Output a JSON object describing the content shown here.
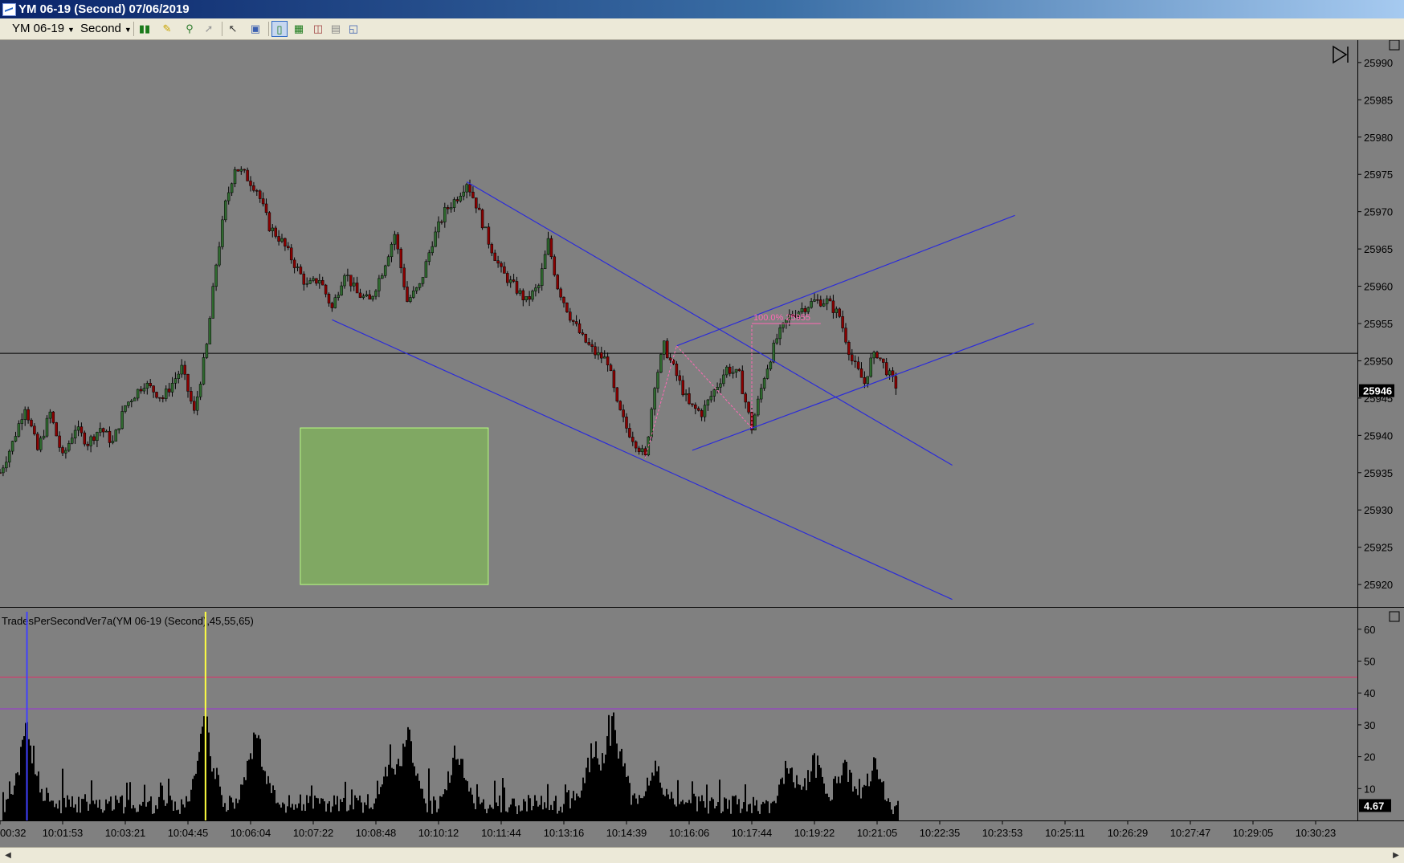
{
  "window": {
    "title": "YM 06-19 (Second)  07/06/2019"
  },
  "toolbar": {
    "instrument": "YM 06-19",
    "interval": "Second",
    "icons": [
      "bar-type-icon",
      "draw-pencil-icon",
      "zoom-icon",
      "pin-icon",
      "cursor-icon",
      "properties-icon",
      "chart-style-icon",
      "chart-trader-icon",
      "data-box-icon",
      "strategy-icon",
      "window-icon"
    ]
  },
  "colors": {
    "background": "#808080",
    "up": "#2f6a2f",
    "down": "#8b0000",
    "channel": "#2b2bd9",
    "fib": "#ff69b4",
    "zone": "#80a863",
    "zone_border": "#b8ff80"
  },
  "chart_data": [
    {
      "type": "line",
      "panel": "price",
      "instrument": "YM 06-19 (Second)",
      "ylim": [
        25917,
        25993
      ],
      "y_ticks": [
        25920,
        25925,
        25930,
        25935,
        25940,
        25945,
        25950,
        25955,
        25960,
        25965,
        25970,
        25975,
        25980,
        25985,
        25990
      ],
      "last_price": "25946",
      "x_ticks": [
        "00:32",
        "10:01:53",
        "10:03:21",
        "10:04:45",
        "10:06:04",
        "10:07:22",
        "10:08:48",
        "10:10:12",
        "10:11:44",
        "10:13:16",
        "10:14:39",
        "10:16:06",
        "10:17:44",
        "10:19:22",
        "10:21:05",
        "10:22:35",
        "10:23:53",
        "10:25:11",
        "10:26:29",
        "10:27:47",
        "10:29:05",
        "10:30:23"
      ],
      "x_tick_index": [
        0,
        1,
        2,
        3,
        4,
        5,
        6,
        7,
        8,
        9,
        10,
        11,
        12,
        13,
        14,
        15,
        16,
        17,
        18,
        19,
        20,
        21
      ],
      "price_path": [
        [
          0.0,
          25935
        ],
        [
          0.2,
          25939
        ],
        [
          0.4,
          25944
        ],
        [
          0.6,
          25938
        ],
        [
          0.8,
          25943
        ],
        [
          1.0,
          25937
        ],
        [
          1.2,
          25941
        ],
        [
          1.4,
          25939
        ],
        [
          1.6,
          25941
        ],
        [
          1.8,
          25939
        ],
        [
          2.0,
          25944
        ],
        [
          2.3,
          25947
        ],
        [
          2.6,
          25945
        ],
        [
          2.9,
          25949
        ],
        [
          3.1,
          25943
        ],
        [
          3.3,
          25952
        ],
        [
          3.45,
          25963
        ],
        [
          3.6,
          25971
        ],
        [
          3.75,
          25976
        ],
        [
          3.9,
          25975
        ],
        [
          4.1,
          25973
        ],
        [
          4.3,
          25968
        ],
        [
          4.5,
          25966
        ],
        [
          4.7,
          25963
        ],
        [
          4.9,
          25960
        ],
        [
          5.1,
          25961
        ],
        [
          5.3,
          25957
        ],
        [
          5.5,
          25962
        ],
        [
          5.7,
          25959
        ],
        [
          5.9,
          25958
        ],
        [
          6.1,
          25962
        ],
        [
          6.3,
          25967
        ],
        [
          6.5,
          25958
        ],
        [
          6.7,
          25960
        ],
        [
          6.9,
          25966
        ],
        [
          7.1,
          25970
        ],
        [
          7.3,
          25972
        ],
        [
          7.45,
          25974
        ],
        [
          7.6,
          25971
        ],
        [
          7.8,
          25966
        ],
        [
          8.0,
          25962
        ],
        [
          8.2,
          25960
        ],
        [
          8.4,
          25958
        ],
        [
          8.6,
          25960
        ],
        [
          8.75,
          25966
        ],
        [
          8.9,
          25960
        ],
        [
          9.1,
          25956
        ],
        [
          9.3,
          25953
        ],
        [
          9.5,
          25951
        ],
        [
          9.7,
          25950
        ],
        [
          9.85,
          25944
        ],
        [
          10.0,
          25941
        ],
        [
          10.15,
          25939
        ],
        [
          10.3,
          25937
        ],
        [
          10.45,
          25947
        ],
        [
          10.6,
          25952
        ],
        [
          10.8,
          25948
        ],
        [
          11.0,
          25944
        ],
        [
          11.2,
          25943
        ],
        [
          11.4,
          25946
        ],
        [
          11.6,
          25949
        ],
        [
          11.8,
          25948
        ],
        [
          12.0,
          25941
        ],
        [
          12.2,
          25948
        ],
        [
          12.4,
          25953
        ],
        [
          12.6,
          25956
        ],
        [
          12.8,
          25957
        ],
        [
          13.0,
          25958
        ],
        [
          13.2,
          25958
        ],
        [
          13.4,
          25956
        ],
        [
          13.6,
          25950
        ],
        [
          13.8,
          25947
        ],
        [
          13.9,
          25950
        ],
        [
          14.0,
          25951
        ],
        [
          14.2,
          25948
        ],
        [
          14.35,
          25946
        ]
      ],
      "drawings": {
        "channel_lines": [
          [
            [
              7.45,
              25974
            ],
            [
              15.2,
              25936
            ]
          ],
          [
            [
              5.3,
              25955.5
            ],
            [
              15.2,
              25918
            ]
          ],
          [
            [
              10.8,
              25952
            ],
            [
              16.2,
              25969.5
            ]
          ],
          [
            [
              11.05,
              25938
            ],
            [
              16.5,
              25955
            ]
          ]
        ],
        "fib_label": "100.0% 25955",
        "zone": {
          "t0": 4.8,
          "t1": 7.8,
          "p_top": 25941,
          "p_bottom": 25920
        },
        "horizontal_line": 25951
      }
    },
    {
      "type": "area",
      "panel": "indicator",
      "title": "TradesPerSecondVer7a(YM  06-19  (Second),45,55,65)",
      "ylim": [
        0,
        66
      ],
      "y_ticks": [
        10,
        20,
        30,
        40,
        50,
        60
      ],
      "last_value": "4.67",
      "levels": [
        {
          "value": 45,
          "color": "#e0306a"
        },
        {
          "value": 35,
          "color": "#9b30d9"
        }
      ],
      "spikes": [
        [
          0.43,
          35
        ],
        [
          3.28,
          36
        ],
        [
          4.1,
          33
        ],
        [
          6.25,
          27
        ],
        [
          6.5,
          36
        ],
        [
          7.3,
          27
        ],
        [
          9.5,
          30
        ],
        [
          9.78,
          41
        ],
        [
          10.45,
          22
        ],
        [
          12.6,
          23
        ],
        [
          13.0,
          24
        ],
        [
          13.5,
          21
        ],
        [
          13.95,
          22
        ]
      ],
      "markers": [
        {
          "t": 0.43,
          "color": "#4040ff"
        },
        {
          "t": 3.28,
          "color": "#ffff40"
        }
      ]
    }
  ]
}
